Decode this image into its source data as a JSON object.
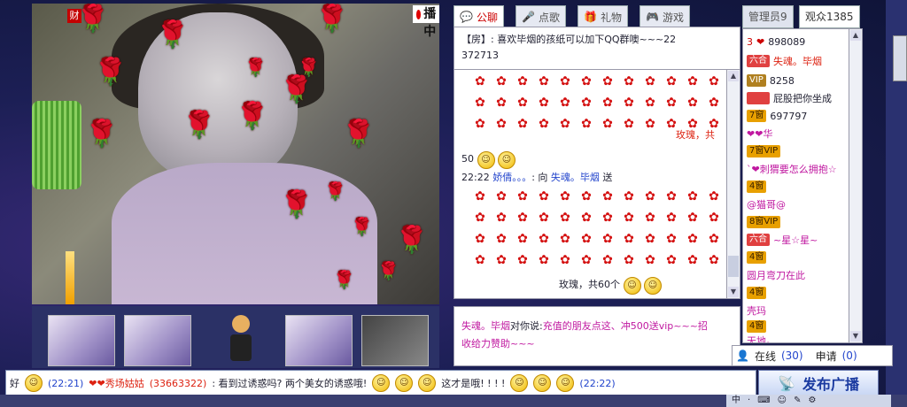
{
  "video": {
    "live_label": "直播中",
    "cai_label": "财"
  },
  "chat_tabs": [
    {
      "label": "公聊",
      "icon": "chat-bubble-icon",
      "active": true
    },
    {
      "label": "点歌",
      "icon": "microphone-icon",
      "active": false
    },
    {
      "label": "礼物",
      "icon": "gift-icon",
      "active": false
    },
    {
      "label": "游戏",
      "icon": "gamepad-icon",
      "active": false
    }
  ],
  "chat": {
    "top_message_prefix": "【房",
    "top_message_text": "】: 喜欢毕烟的孩纸可以加下QQ群噢~~~22",
    "top_message_cont": "372713",
    "gift_line_1_tail": "玫瑰，共",
    "gift_line_1_count_prefix": "50",
    "line2_time": "22:22",
    "line2_user": "娇倩。。。",
    "line2_mid": ": 向",
    "line2_target": "失魂。毕烟",
    "line2_verb": "送",
    "gift_line_2_tail": "玫瑰，共60个",
    "rose_symbol": "✿"
  },
  "private_chat": {
    "sender": "失魂。毕烟",
    "mid": "对你说:",
    "text": "充值的朋友点这、冲500送vip~~~招",
    "text2": "收给力赞助~~~"
  },
  "right_panel": {
    "tab_admins": "管理员9",
    "tab_audience": "观众1385",
    "users": [
      {
        "badge": "3",
        "badge_style": "heart",
        "name": "898089"
      },
      {
        "badge": "六合",
        "badge_style": "red",
        "name": "失魂。毕烟"
      },
      {
        "badge": "VIP",
        "badge_style": "vip",
        "name": "8258"
      },
      {
        "badge": "",
        "badge_style": "red",
        "name": "屁股把你坐成"
      },
      {
        "badge": "7窗",
        "badge_style": "gold",
        "name": "697797"
      },
      {
        "badge": "",
        "badge_style": "none",
        "name": "❤❤华"
      },
      {
        "badge": "7窗VIP",
        "badge_style": "gold",
        "name": ""
      },
      {
        "badge": "",
        "badge_style": "none",
        "name": "`❤刺猬要怎么拥抱☆"
      },
      {
        "badge": "4窗",
        "badge_style": "gold",
        "name": ""
      },
      {
        "badge": "",
        "badge_style": "none",
        "name": "@猫哥@"
      },
      {
        "badge": "8窗VIP",
        "badge_style": "gold",
        "name": ""
      },
      {
        "badge": "六合",
        "badge_style": "red",
        "name": "~星☆星~"
      },
      {
        "badge": "4窗",
        "badge_style": "gold",
        "name": ""
      },
      {
        "badge": "",
        "badge_style": "none",
        "name": "圆月弯刀在此"
      },
      {
        "badge": "4窗",
        "badge_style": "gold",
        "name": ""
      },
      {
        "badge": "",
        "badge_style": "none",
        "name": "壳玛"
      },
      {
        "badge": "4窗",
        "badge_style": "gold",
        "name": ""
      },
      {
        "badge": "",
        "badge_style": "none",
        "name": "天地。"
      }
    ],
    "online_label": "在线",
    "online_count": "(30)",
    "apply_label": "申请",
    "apply_count": "(0)"
  },
  "broadcast": {
    "left_char": "好",
    "time1": "(22:21)",
    "user": "❤❤秀场姑姑",
    "qq": "(33663322)",
    "text": ": 看到过诱惑吗? 两个美女的诱惑哦!",
    "text2": "这才是哦! ! ! !",
    "time2": "(22:22)",
    "publish_label": "发布广播"
  },
  "ime": {
    "items": [
      "中",
      "·",
      "⌨",
      "☺",
      "✎",
      "⚙"
    ]
  },
  "colors": {
    "accent_red": "#d21111",
    "link_blue": "#2244cc",
    "magenta": "#c018a0"
  }
}
